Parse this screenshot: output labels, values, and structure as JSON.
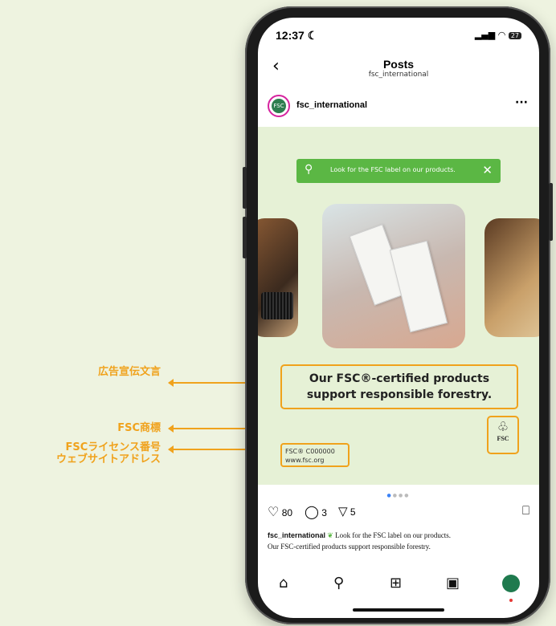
{
  "annotations": {
    "ad_copy": "広告宣伝文言",
    "trademark": "FSC商標",
    "license_line1": "FSCライセンス番号",
    "license_line2": "ウェブサイトアドレス"
  },
  "status_bar": {
    "time": "12:37",
    "battery": "27"
  },
  "nav": {
    "title": "Posts",
    "subtitle": "fsc_international"
  },
  "post_header": {
    "username": "fsc_international",
    "avatar_label": "FSC"
  },
  "post": {
    "search_text": "Look for the FSC label on our products.",
    "slogan_line1": "Our FSC®-certified products",
    "slogan_line2": "support responsible forestry.",
    "logo_text": "FSC",
    "license_number": "FSC® C000000",
    "website": "www.fsc.org"
  },
  "actions": {
    "likes": "80",
    "comments": "3",
    "shares": "5"
  },
  "caption": {
    "username": "fsc_international",
    "text_line1": "Look for the FSC label on our products.",
    "text_line2": "Our FSC-certified products support responsible forestry."
  },
  "colors": {
    "accent": "#f0a21c",
    "bar_green": "#5bb744",
    "post_bg": "#e6f1d6"
  }
}
